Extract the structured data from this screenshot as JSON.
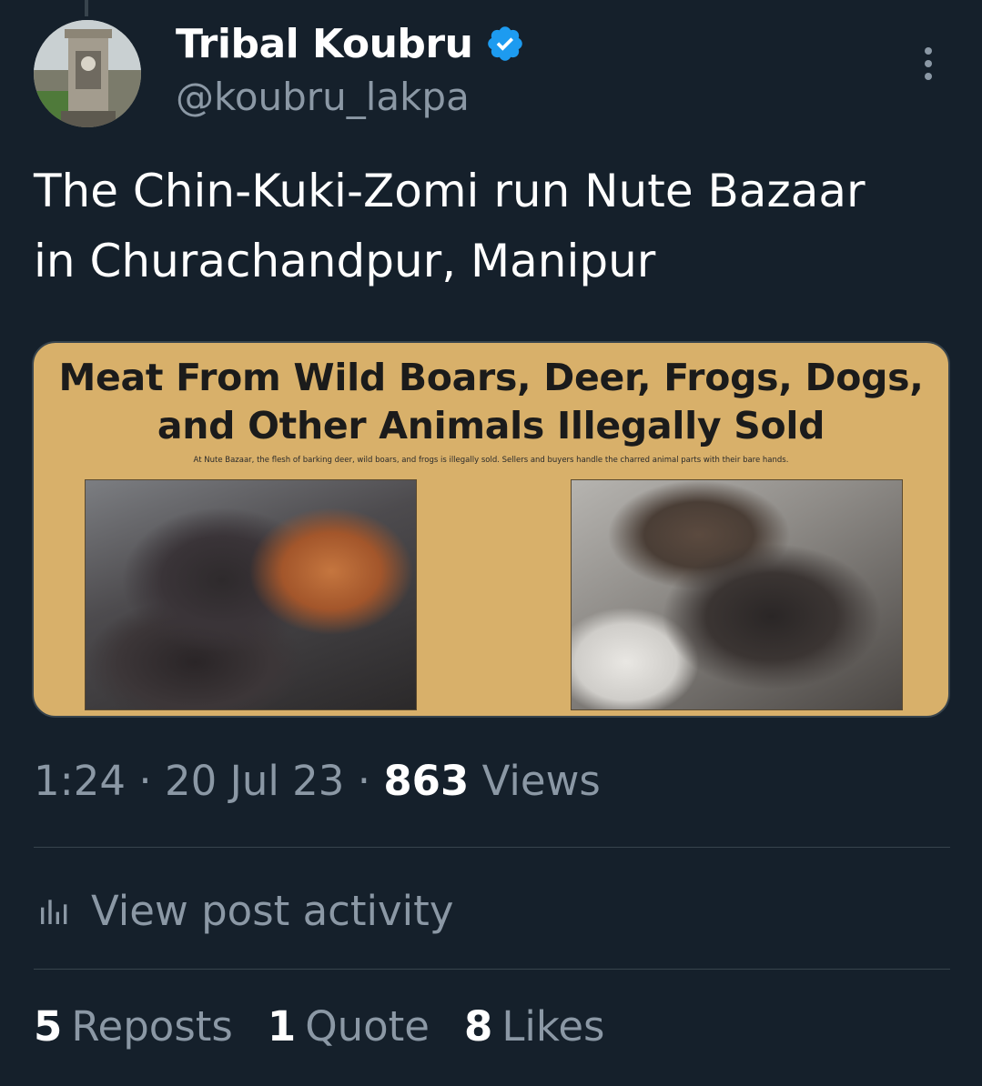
{
  "author": {
    "display_name": "Tribal Koubru",
    "handle": "@koubru_lakpa",
    "verified": true
  },
  "tweet": {
    "text_line1": "The Chin-Kuki-Zomi run Nute Bazaar",
    "text_line2": "in Churachandpur, Manipur"
  },
  "media": {
    "heading_line1": "Meat From Wild Boars, Deer, Frogs, Dogs,",
    "heading_line2": "and Other Animals Illegally Sold",
    "caption": "At Nute Bazaar, the flesh of barking deer, wild boars, and frogs is illegally sold. Sellers and buyers handle the charred animal parts with their bare hands."
  },
  "meta": {
    "time": "1:24",
    "separator": "·",
    "date": "20 Jul 23",
    "views_count": "863",
    "views_label": "Views"
  },
  "activity": {
    "label": "View post activity"
  },
  "stats": [
    {
      "count": "5",
      "label": "Reposts"
    },
    {
      "count": "1",
      "label": "Quote"
    },
    {
      "count": "8",
      "label": "Likes"
    }
  ],
  "colors": {
    "background": "#15202b",
    "text_primary": "#ffffff",
    "text_secondary": "#8b98a5",
    "verified_blue": "#1d9bf0",
    "divider": "#38444d",
    "media_background": "#d8b06a"
  },
  "icons": {
    "verified": "verified-badge-icon",
    "more": "more-vertical-icon",
    "activity": "bar-chart-icon"
  }
}
